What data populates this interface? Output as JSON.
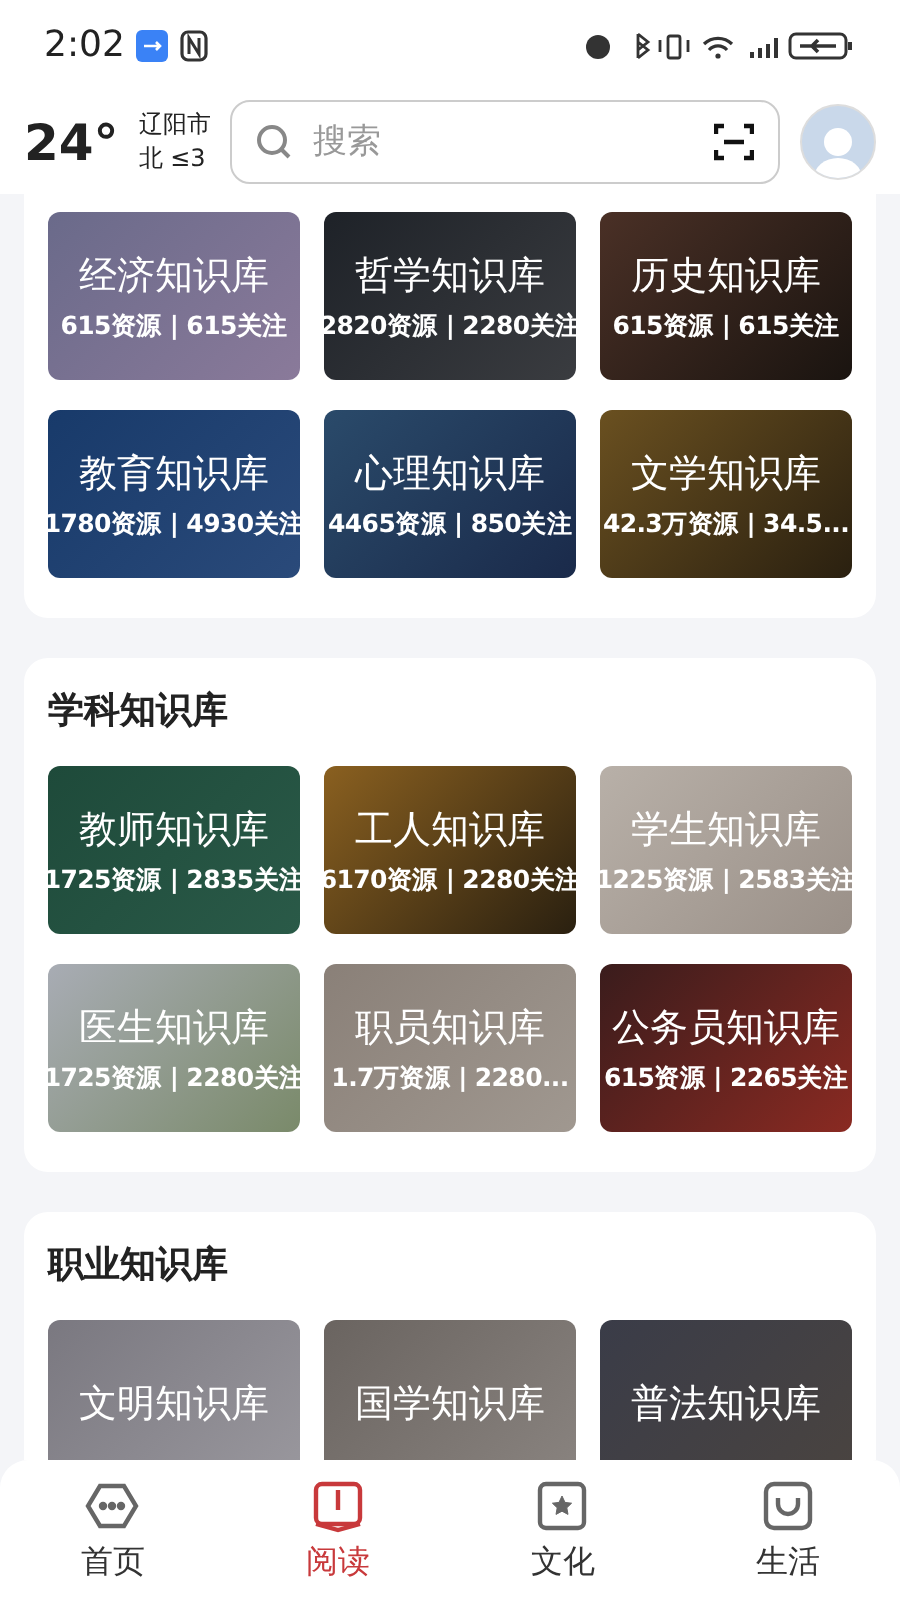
{
  "status_bar": {
    "time": "2:02"
  },
  "header": {
    "temperature": "24°",
    "city": "辽阳市",
    "wind": "北 ≤3",
    "search": {
      "placeholder": "搜索"
    }
  },
  "sections": [
    {
      "tiles": [
        {
          "title": "经济知识库",
          "stats": "615资源 | 615关注"
        },
        {
          "title": "哲学知识库",
          "stats": "2820资源 | 2280关注"
        },
        {
          "title": "历史知识库",
          "stats": "615资源 | 615关注"
        },
        {
          "title": "教育知识库",
          "stats": "1780资源 | 4930关注"
        },
        {
          "title": "心理知识库",
          "stats": "4465资源 | 850关注"
        },
        {
          "title": "文学知识库",
          "stats": "42.3万资源 | 34.5..."
        }
      ]
    },
    {
      "title": "学科知识库",
      "tiles": [
        {
          "title": "教师知识库",
          "stats": "1725资源 | 2835关注"
        },
        {
          "title": "工人知识库",
          "stats": "6170资源 | 2280关注"
        },
        {
          "title": "学生知识库",
          "stats": "1225资源 | 2583关注"
        },
        {
          "title": "医生知识库",
          "stats": "1725资源 | 2280关注"
        },
        {
          "title": "职员知识库",
          "stats": "1.7万资源 | 2280..."
        },
        {
          "title": "公务员知识库",
          "stats": "615资源 | 2265关注"
        }
      ]
    },
    {
      "title": "职业知识库",
      "tiles": [
        {
          "title": "文明知识库"
        },
        {
          "title": "国学知识库"
        },
        {
          "title": "普法知识库"
        }
      ]
    }
  ],
  "nav": [
    {
      "label": "首页",
      "kind": "home",
      "selected": false
    },
    {
      "label": "阅读",
      "kind": "read",
      "selected": true
    },
    {
      "label": "文化",
      "kind": "culture",
      "selected": false
    },
    {
      "label": "生活",
      "kind": "life",
      "selected": false
    }
  ]
}
